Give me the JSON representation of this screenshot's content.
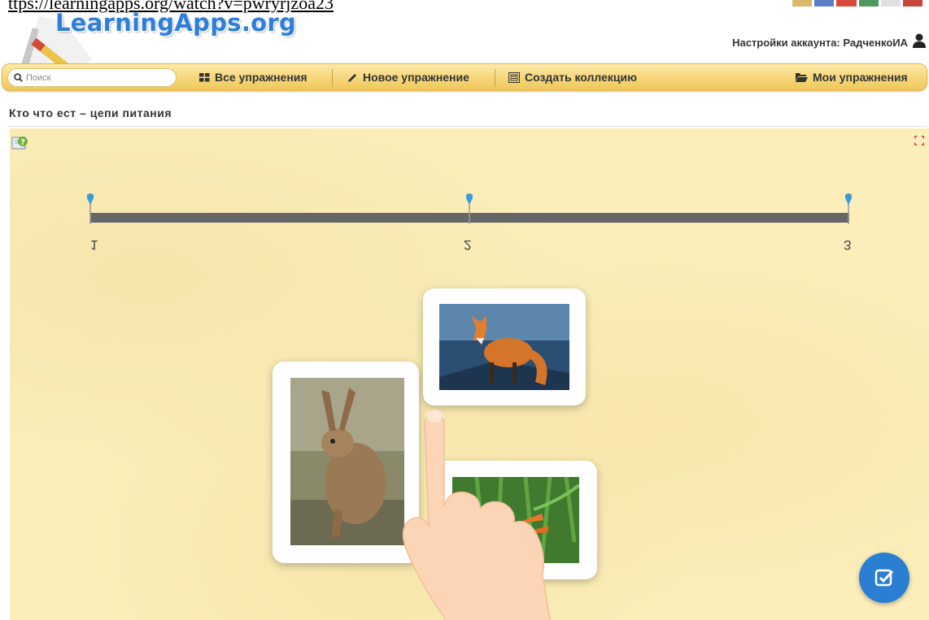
{
  "browser": {
    "url_fragment": "ttps://learningapps.org/watch?v=pwryrjzoa23"
  },
  "header": {
    "logo_text": "LearningApps.org",
    "account_text": "Настройки аккаунта: РадченкоИА"
  },
  "toolbar": {
    "search_placeholder": "Поиск",
    "all_exercises": "Все упражнения",
    "new_exercise": "Новое упражнение",
    "create_collection": "Создать коллекцию",
    "my_exercises": "Мои упражнения"
  },
  "exercise": {
    "title": "Кто что ест – цепи питания",
    "timeline_labels": [
      "1",
      "2",
      "3"
    ],
    "cards": [
      {
        "subject": "fox"
      },
      {
        "subject": "hare"
      },
      {
        "subject": "carrot"
      }
    ]
  },
  "icons": {
    "help": "help-icon",
    "fullscreen": "fullscreen-icon",
    "check": "check-icon",
    "search": "search-icon",
    "grid": "grid-icon",
    "pencil": "pencil-icon",
    "collection": "collection-icon",
    "folder": "folder-icon",
    "user": "user-icon"
  },
  "colors": {
    "logo_blue": "#2f7fd8",
    "toolbar_gold": "#f6d679",
    "stage_bg": "#fbeeba",
    "timeline_gray": "#666666",
    "pin_blue": "#3a9bd9",
    "check_blue": "#2a7fd3"
  }
}
